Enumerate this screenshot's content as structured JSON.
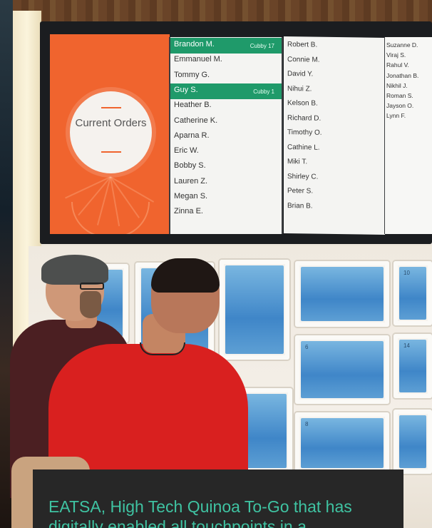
{
  "screen": {
    "panel_title": "Current Orders",
    "columns": [
      {
        "names": [
          "Brandon M.",
          "Emmanuel M.",
          "Tommy G.",
          "Guy S.",
          "Heather B.",
          "Catherine K.",
          "Aparna R.",
          "Eric W.",
          "Bobby S.",
          "Lauren Z.",
          "Megan S.",
          "Zinna E."
        ],
        "highlighted": [
          {
            "index": 0,
            "cubby": "Cubby 17"
          },
          {
            "index": 3,
            "cubby": "Cubby 1"
          }
        ]
      },
      {
        "names": [
          "Robert B.",
          "Connie M.",
          "David Y.",
          "Nihui Z.",
          "Kelson B.",
          "Richard D.",
          "Timothy O.",
          "Cathine L.",
          "Miki T.",
          "Shirley C.",
          "Peter S.",
          "Brian B."
        ]
      },
      {
        "names": [
          "Suzanne D.",
          "Viraj S.",
          "Rahul V.",
          "Jonathan B.",
          "Nikhil J.",
          "Roman S.",
          "Jayson O.",
          "Lynn F."
        ]
      }
    ],
    "highlight_color": "#1f9a6a",
    "panel_color": "#f0642e"
  },
  "lockers": {
    "numbers": [
      "10",
      "6",
      "14",
      "8"
    ],
    "glass_color": "#4a90cf"
  },
  "caption": {
    "text": "EATSA, High Tech Quinoa To-Go that has digitally enabled all touchpoints in a",
    "text_color": "#3fc3a2",
    "background": "#272727"
  }
}
